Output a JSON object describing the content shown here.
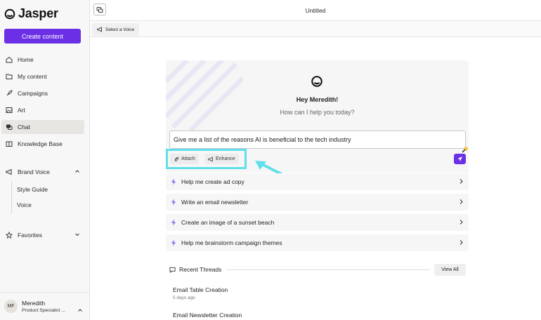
{
  "app": {
    "brand": "Jasper",
    "document_title": "Untitled"
  },
  "sidebar": {
    "create_label": "Create content",
    "items": [
      {
        "label": "Home",
        "icon": "home-icon"
      },
      {
        "label": "My content",
        "icon": "folder-icon"
      },
      {
        "label": "Campaigns",
        "icon": "rocket-icon"
      },
      {
        "label": "Art",
        "icon": "image-icon"
      },
      {
        "label": "Chat",
        "icon": "chat-icon",
        "active": true
      },
      {
        "label": "Knowledge Base",
        "icon": "book-icon"
      },
      {
        "label": "Brand Voice",
        "icon": "megaphone-icon"
      },
      {
        "label": "Favorites",
        "icon": "star-icon"
      }
    ],
    "brand_voice_sub": [
      "Style Guide",
      "Voice"
    ],
    "user": {
      "initials": "MF",
      "name": "Meredith",
      "role": "Product Specialist ..."
    }
  },
  "tabbar": {
    "voice_label": "Select a Voice"
  },
  "chat": {
    "greeting": "Hey Meredith!",
    "subtitle": "How can I help you today?",
    "prompt_value": "Give me a list of the reasons AI is beneficial to the tech industry",
    "attach_label": "Attach",
    "enhance_label": "Enhance",
    "suggestions": [
      "Help me create ad copy",
      "Write an email newsletter",
      "Create an image of a sunset beach",
      "Help me brainstorm campaign themes"
    ]
  },
  "threads": {
    "heading": "Recent Threads",
    "view_all": "View All",
    "items": [
      {
        "title": "Email Table Creation",
        "time": "5 days ago"
      },
      {
        "title": "Email Newsletter Creation",
        "time": ""
      }
    ]
  },
  "colors": {
    "accent": "#6b2fe6",
    "highlight": "#5fe0ea",
    "panel": "#f7f6f6"
  }
}
